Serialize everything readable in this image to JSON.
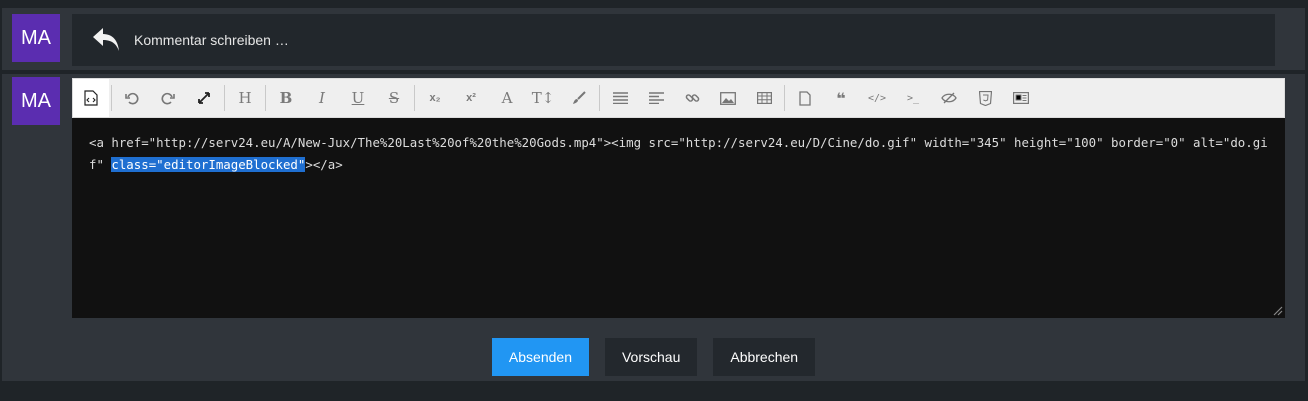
{
  "comment_row": {
    "avatar_initials": "MA",
    "reply_label": "Kommentar schreiben …"
  },
  "editor_row": {
    "avatar_initials": "MA",
    "toolbar": [
      {
        "name": "source-code-icon",
        "label": "",
        "active": true
      },
      {
        "sep": true
      },
      {
        "name": "undo-icon",
        "label": ""
      },
      {
        "name": "redo-icon",
        "label": ""
      },
      {
        "name": "fullscreen-icon",
        "label": ""
      },
      {
        "sep": true
      },
      {
        "name": "heading-icon",
        "label": "H"
      },
      {
        "sep": true
      },
      {
        "name": "bold-icon",
        "label": "B"
      },
      {
        "name": "italic-icon",
        "label": "I"
      },
      {
        "name": "underline-icon",
        "label": "U"
      },
      {
        "name": "strikethrough-icon",
        "label": "S"
      },
      {
        "sep": true
      },
      {
        "name": "subscript-icon",
        "label": "x₂"
      },
      {
        "name": "superscript-icon",
        "label": "x²"
      },
      {
        "name": "font-icon",
        "label": "A"
      },
      {
        "name": "font-size-icon",
        "label": "T↕"
      },
      {
        "name": "paint-brush-icon",
        "label": ""
      },
      {
        "sep": true
      },
      {
        "name": "list-icon",
        "label": ""
      },
      {
        "name": "align-icon",
        "label": ""
      },
      {
        "name": "link-icon",
        "label": ""
      },
      {
        "name": "image-icon",
        "label": ""
      },
      {
        "name": "table-icon",
        "label": ""
      },
      {
        "sep": true
      },
      {
        "name": "page-icon",
        "label": ""
      },
      {
        "name": "quote-icon",
        "label": "❝"
      },
      {
        "name": "code-icon",
        "label": "</>"
      },
      {
        "name": "terminal-icon",
        "label": ">_"
      },
      {
        "name": "spoiler-icon",
        "label": ""
      },
      {
        "name": "html-icon",
        "label": ""
      },
      {
        "name": "media-icon",
        "label": ""
      }
    ],
    "source_text_before": "<a href=\"http://serv24.eu/A/New-Jux/The%20Last%20of%20the%20Gods.mp4\"><img src=\"http://serv24.eu/D/Cine/do.gif\" width=\"345\" height=\"100\" border=\"0\" alt=\"do.gif\" ",
    "source_text_selected": "class=\"editorImageBlocked\"",
    "source_text_after": "></a>"
  },
  "buttons": {
    "submit": "Absenden",
    "preview": "Vorschau",
    "cancel": "Abbrechen"
  },
  "colors": {
    "avatar": "#5b2db0",
    "primary": "#2196f3",
    "selection": "#1f6fd1"
  }
}
